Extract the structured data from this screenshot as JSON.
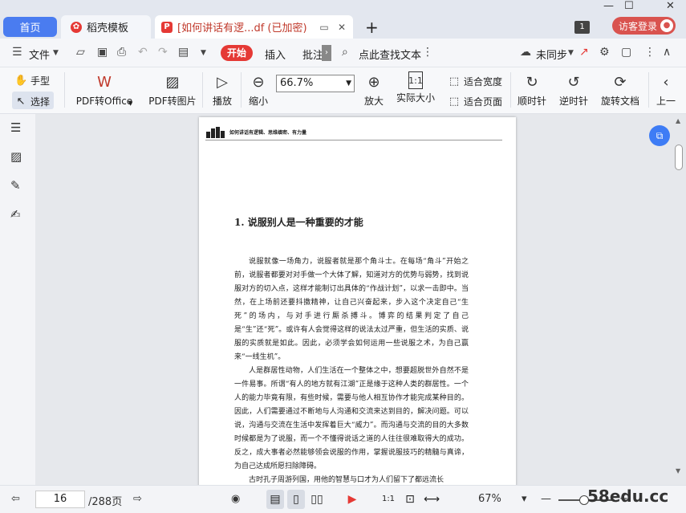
{
  "tabs": {
    "home": "首页",
    "template": "稻壳模板",
    "document": "[如何讲话有逻...df (已加密)"
  },
  "window": {
    "badge": "1",
    "login": "访客登录"
  },
  "menu": {
    "file": "文件",
    "start": "开始",
    "insert": "插入",
    "annotate": "批注",
    "search": "点此查找文本",
    "sync": "未同步"
  },
  "ribbon": {
    "hand": "手型",
    "select": "选择",
    "pdf_to_office": "PDF转Office",
    "pdf_to_image": "PDF转图片",
    "play": "播放",
    "zoom_out": "缩小",
    "zoom_value": "66.7%",
    "zoom_in": "放大",
    "actual_size": "实际大小",
    "fit_width": "适合宽度",
    "fit_page": "适合页面",
    "rotate_cw": "顺时针",
    "rotate_ccw": "逆时针",
    "rotate_doc": "旋转文档",
    "prev": "上一"
  },
  "page": {
    "header": "如何讲话有逻辑、思维缜密、有力量",
    "chapter": "1. 说服别人是一种重要的才能",
    "paragraphs": [
      "说服就像一场角力，说服者就是那个角斗士。在每场“角斗”开始之前，说服者都要对对手做一个大体了解，知道对方的优势与弱势，找到说服对方的切入点，这样才能制订出具体的“作战计划”，以求一击即中。当然，在上场前还要抖擞精神，让自己兴奋起来，步入这个决定自己“生死”的场内，与对手进行厮杀搏斗。博弈的结果判定了自己是“生”还“死”。或许有人会觉得这样的说法太过严重，但生活的实质、说服的实质就是如此。因此，必须学会如何运用一些说服之术，为自己赢来“一线生机”。",
      "人是群居性动物，人们生活在一个整体之中，想要超脱世外自然不是一件易事。所谓“有人的地方就有江湖”正是缘于这种人类的群居性。一个人的能力毕竟有限，有些时候，需要与他人相互协作才能完成某种目的。因此，人们需要通过不断地与人沟通和交流来达到目的，解决问题。可以说，沟通与交流在生活中发挥着巨大“威力”。而沟通与交流的目的大多数时候都是为了说服，而一个不懂得说话之道的人往往很难取得大的成功。反之，成大事者必然能够领会说服的作用，掌握说服技巧的精髓与真谛，为自己达成所愿扫除障碍。",
      "古时孔子周游列国，用他的智慧与口才为人们留下了都远流长"
    ]
  },
  "status": {
    "current_page": "16",
    "total_pages": "/288页",
    "zoom": "67%",
    "zoom_fraction": 0.45,
    "watermark": "58edu.cc"
  }
}
